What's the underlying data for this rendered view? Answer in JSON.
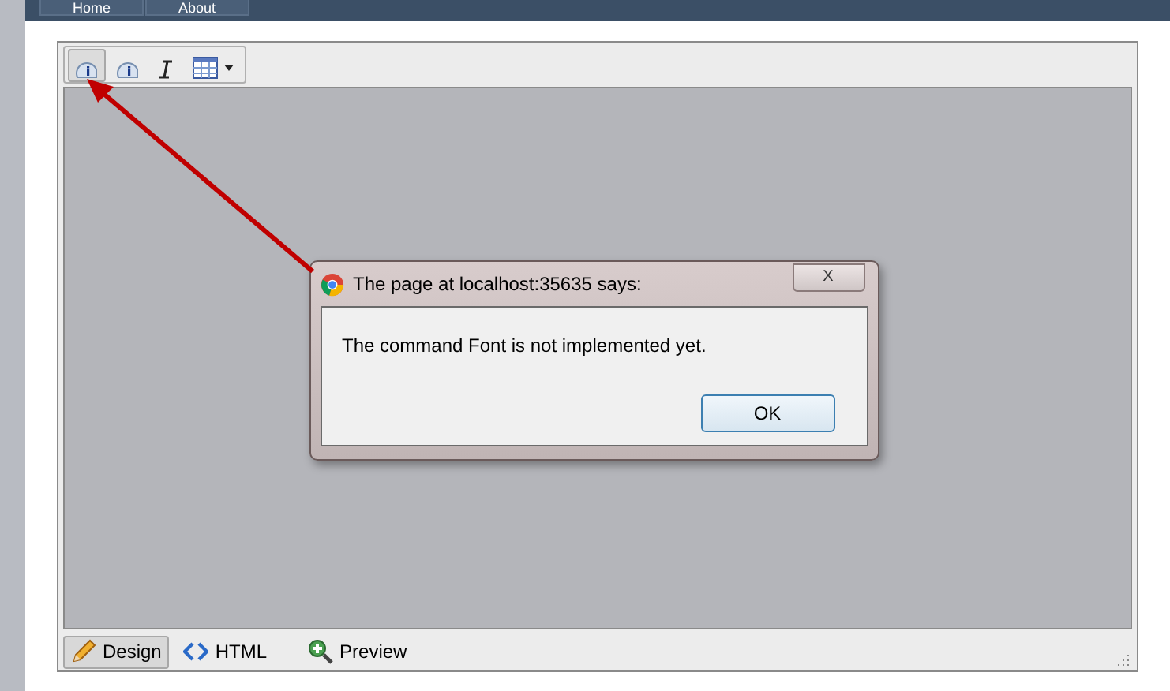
{
  "nav": {
    "tabs": [
      {
        "label": "Home"
      },
      {
        "label": "About"
      }
    ]
  },
  "toolbar": {
    "buttons": [
      {
        "kind": "info",
        "selected": true
      },
      {
        "kind": "info",
        "selected": false
      },
      {
        "kind": "italic",
        "selected": false
      },
      {
        "kind": "table",
        "selected": false
      }
    ]
  },
  "dialog": {
    "title": "The page at localhost:35635 says:",
    "close": "X",
    "message": "The command Font is not implemented yet.",
    "ok": "OK"
  },
  "mode_tabs": [
    {
      "label": "Design",
      "kind": "design",
      "selected": true
    },
    {
      "label": "HTML",
      "kind": "html",
      "selected": false
    },
    {
      "label": "Preview",
      "kind": "preview",
      "selected": false
    }
  ]
}
